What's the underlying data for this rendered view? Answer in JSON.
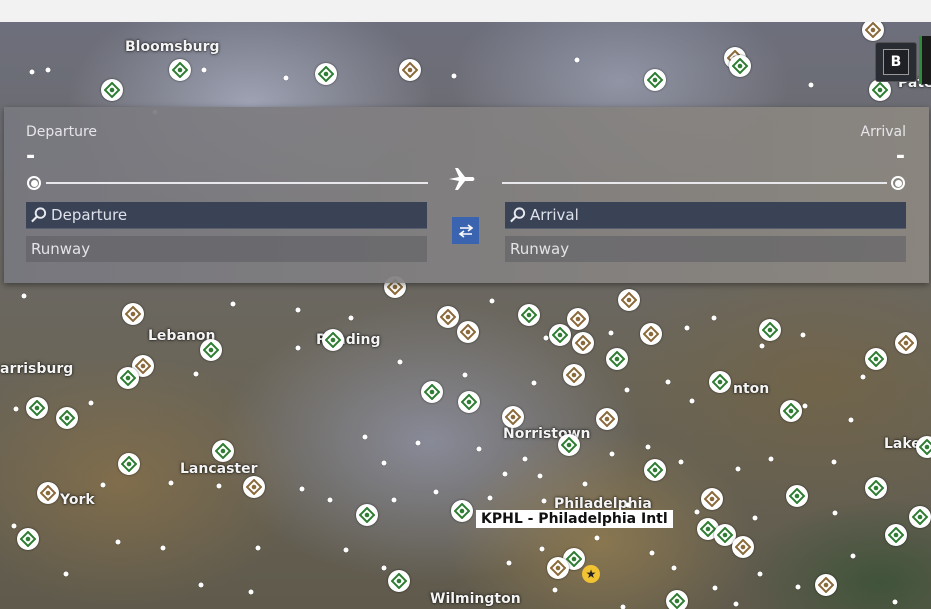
{
  "browser": {},
  "map": {
    "labels": [
      {
        "text": "Bloomsburg"
      },
      {
        "text": "Lebanon"
      },
      {
        "text": "Reading"
      },
      {
        "text": "arrisburg"
      },
      {
        "text": "Lancaster"
      },
      {
        "text": "York"
      },
      {
        "text": "Norristown"
      },
      {
        "text": "Philadelphia"
      },
      {
        "text": "Wilmington"
      },
      {
        "text": "nton"
      },
      {
        "text": "Lakew"
      },
      {
        "text": "Pate"
      }
    ],
    "tooltip": "KPHL - Philadelphia Intl",
    "selected_marker_icon": "star-icon",
    "airport_icon_colors": {
      "green": "#2e7d32",
      "brown": "#8a6a3a"
    }
  },
  "corner_button": {
    "label": "B"
  },
  "flight_panel": {
    "departure": {
      "label": "Departure",
      "value": "-",
      "search_placeholder": "Departure",
      "runway_label": "Runway"
    },
    "arrival": {
      "label": "Arrival",
      "value": "-",
      "search_placeholder": "Arrival",
      "runway_label": "Runway"
    },
    "center_icon": "airplane-icon",
    "swap_icon": "swap-arrows-icon",
    "accent_color": "#3b64b0"
  }
}
